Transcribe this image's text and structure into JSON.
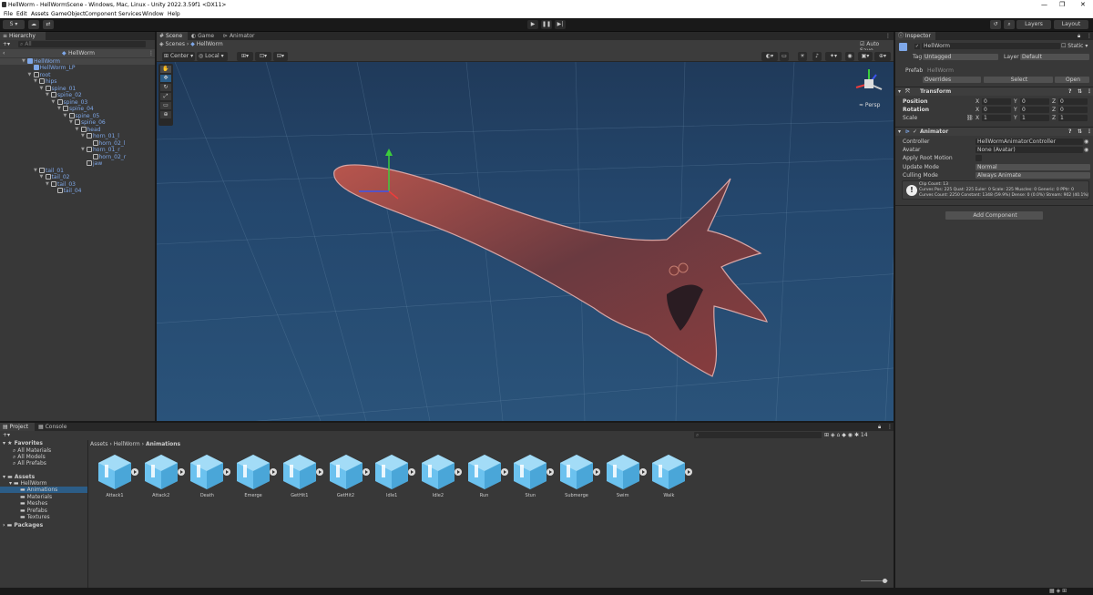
{
  "window": {
    "title": "HellWorm - HellWormScene - Windows, Mac, Linux - Unity 2022.3.59f1 <DX11>",
    "controls": [
      "—",
      "❐",
      "✕"
    ]
  },
  "menu": [
    "File",
    "Edit",
    "Assets",
    "GameObject",
    "Component",
    "Services",
    "Window",
    "Help"
  ],
  "toolbar": {
    "account_label": "S ▾",
    "layers_label": "Layers",
    "layout_label": "Layout"
  },
  "hierarchy": {
    "tab": "Hierarchy",
    "search_placeholder": "All",
    "scene_name": "HellWorm",
    "items": [
      {
        "label": "HellWorm",
        "arrow": "▼"
      },
      {
        "label": "HellWorm_LP",
        "arrow": ""
      },
      {
        "label": "root",
        "arrow": "▼"
      },
      {
        "label": "hips",
        "arrow": "▼"
      },
      {
        "label": "spine_01",
        "arrow": "▼"
      },
      {
        "label": "spine_02",
        "arrow": "▼"
      },
      {
        "label": "spine_03",
        "arrow": "▼"
      },
      {
        "label": "spine_04",
        "arrow": "▼"
      },
      {
        "label": "spine_05",
        "arrow": "▼"
      },
      {
        "label": "spine_06",
        "arrow": "▼"
      },
      {
        "label": "head",
        "arrow": "▼"
      },
      {
        "label": "horn_01_l",
        "arrow": "▼"
      },
      {
        "label": "horn_02_l",
        "arrow": ""
      },
      {
        "label": "horn_01_r",
        "arrow": "▼"
      },
      {
        "label": "horn_02_r",
        "arrow": ""
      },
      {
        "label": "jaw",
        "arrow": ""
      },
      {
        "label": "tail_01",
        "arrow": "▼"
      },
      {
        "label": "tail_02",
        "arrow": "▼"
      },
      {
        "label": "tail_03",
        "arrow": "▼"
      },
      {
        "label": "tail_04",
        "arrow": ""
      }
    ]
  },
  "scene": {
    "tabs": [
      "Scene",
      "Game",
      "Animator"
    ],
    "breadcrumb_root": "Scenes",
    "breadcrumb_current": "HellWorm",
    "auto_save": "Auto Save",
    "pivot": "Center",
    "space": "Local",
    "persp_label": "≈ Persp"
  },
  "inspector": {
    "tab": "Inspector",
    "object_name": "HellWorm",
    "static_label": "Static",
    "tag_label": "Tag",
    "tag_value": "Untagged",
    "layer_label": "Layer",
    "layer_value": "Default",
    "prefab_label": "Prefab",
    "prefab_value": "HellWorm",
    "overrides": "Overrides",
    "select": "Select",
    "open": "Open",
    "transform": {
      "title": "Transform",
      "position_label": "Position",
      "rotation_label": "Rotation",
      "scale_label": "Scale",
      "position": [
        "0",
        "0",
        "0"
      ],
      "rotation": [
        "0",
        "0",
        "0"
      ],
      "scale": [
        "1",
        "1",
        "1"
      ],
      "axis": [
        "X",
        "Y",
        "Z"
      ]
    },
    "animator": {
      "title": "Animator",
      "controller_label": "Controller",
      "controller_value": "HellWormAnimatorController",
      "avatar_label": "Avatar",
      "avatar_value": "None (Avatar)",
      "root_motion_label": "Apply Root Motion",
      "update_label": "Update Mode",
      "update_value": "Normal",
      "culling_label": "Culling Mode",
      "culling_value": "Always Animate",
      "info_1": "Clip Count: 13",
      "info_2": "Curves Pos: 225 Quat: 225 Euler: 0 Scale: 225 Muscles: 0 Generic: 0 PPtr: 0",
      "info_3": "Curves Count: 2250 Constant: 1348 (59.9%) Dense: 0 (0.0%) Stream: 902 (40.1%)"
    },
    "add_component": "Add Component"
  },
  "project": {
    "tabs": [
      "Project",
      "Console"
    ],
    "favorites_label": "Favorites",
    "favorites": [
      "All Materials",
      "All Models",
      "All Prefabs"
    ],
    "assets_label": "Assets",
    "hellworm_folder": "HellWorm",
    "subfolders": [
      "Animations",
      "Materials",
      "Meshes",
      "Prefabs",
      "Textures"
    ],
    "packages_label": "Packages",
    "path": [
      "Assets",
      "HellWorm",
      "Animations"
    ],
    "count": "14",
    "assets": [
      "Attack1",
      "Attack2",
      "Death",
      "Emerge",
      "GetHit1",
      "GetHit2",
      "Idle1",
      "Idle2",
      "Run",
      "Stun",
      "Submerge",
      "Swim",
      "Walk"
    ]
  },
  "colors": {
    "accent": "#7ea7e8",
    "selection": "#2c5d87",
    "panel": "#383838"
  }
}
